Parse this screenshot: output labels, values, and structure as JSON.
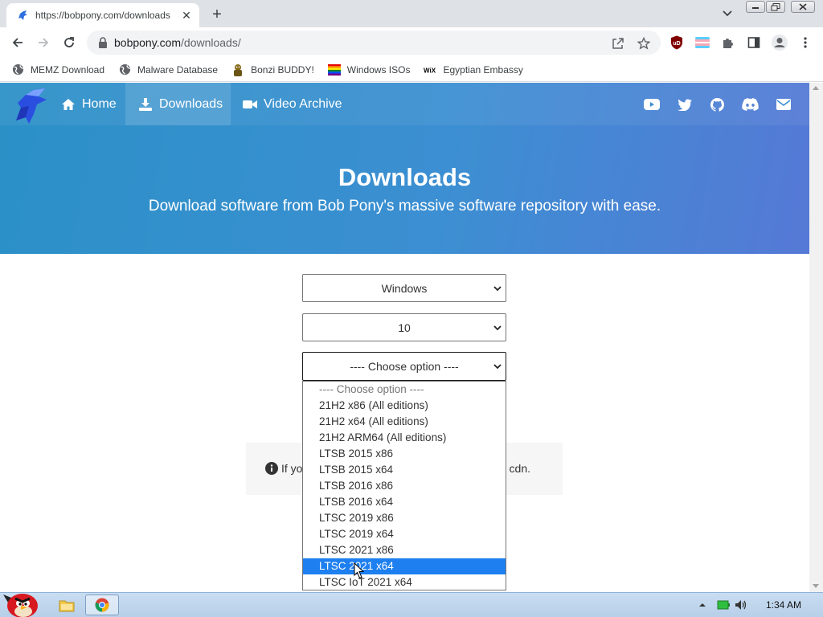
{
  "browser": {
    "tab_title": "https://bobpony.com/downloads",
    "tab_close": "✕",
    "new_tab": "+",
    "address_host": "bobpony.com",
    "address_path": "/downloads/",
    "bookmarks": [
      {
        "label": "MEMZ Download",
        "icon": "globe-icon"
      },
      {
        "label": "Malware Database",
        "icon": "globe-icon"
      },
      {
        "label": "Bonzi BUDDY!",
        "icon": "bonzi-icon"
      },
      {
        "label": "Windows ISOs",
        "icon": "rainbow-flag-icon"
      },
      {
        "label": "Egyptian Embassy",
        "icon": "wix-icon"
      }
    ],
    "wix_text": "WiX",
    "ublock_text": "uD"
  },
  "site": {
    "nav": [
      {
        "label": "Home",
        "icon": "home-icon"
      },
      {
        "label": "Downloads",
        "icon": "download-icon"
      },
      {
        "label": "Video Archive",
        "icon": "video-icon"
      }
    ],
    "social": [
      "youtube-icon",
      "twitter-icon",
      "github-icon",
      "discord-icon",
      "email-icon"
    ]
  },
  "hero": {
    "title": "Downloads",
    "subtitle": "Download software from Bob Pony's massive software repository with ease."
  },
  "selects": {
    "os": "Windows",
    "version": "10",
    "edition": "---- Choose option ----"
  },
  "notice": {
    "left_text": "If yo",
    "right_text": "cdn."
  },
  "dropdown": {
    "options": [
      "---- Choose option ----",
      "21H2 x86 (All editions)",
      "21H2 x64 (All editions)",
      "21H2 ARM64 (All editions)",
      "LTSB 2015 x86",
      "LTSB 2015 x64",
      "LTSB 2016 x86",
      "LTSB 2016 x64",
      "LTSC 2019 x86",
      "LTSC 2019 x64",
      "LTSC 2021 x86",
      "LTSC 2021 x64",
      "LTSC IoT 2021 x64"
    ],
    "highlighted": "LTSC 2021 x64"
  },
  "taskbar": {
    "clock": "1:34 AM"
  },
  "colors": {
    "hero_start": "#2b90c7",
    "hero_end": "#5579d6",
    "highlight": "#1e7ff0"
  }
}
